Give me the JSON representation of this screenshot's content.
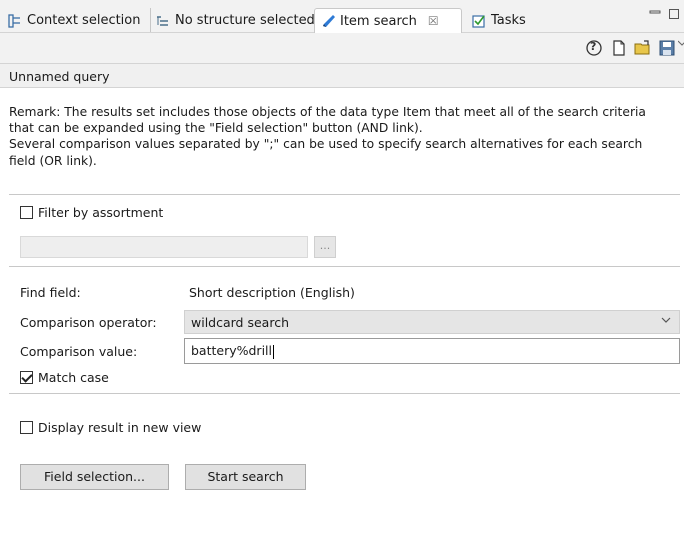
{
  "tabs": [
    {
      "label": "Context selection",
      "icon": "hierarchy-icon"
    },
    {
      "label": "No structure selected",
      "icon": "structure-icon"
    },
    {
      "label": "Item search",
      "icon": "pen-icon",
      "close": "☒",
      "active": true
    },
    {
      "label": "Tasks",
      "icon": "tasks-icon"
    }
  ],
  "toolbar": {
    "help": "?",
    "icons": [
      "help-icon",
      "new-document-icon",
      "open-folder-icon",
      "save-icon"
    ]
  },
  "query": {
    "title": "Unnamed query",
    "remark_lines": [
      "Remark: The results set includes those objects of the data type Item that meet all of the search criteria",
      "that can be expanded using the \"Field selection\" button (AND link).",
      "Several comparison values separated by \";\" can be used to specify search alternatives for each search",
      "field (OR link)."
    ],
    "filter_assortment": {
      "label": "Filter by assortment",
      "checked": false
    },
    "assortment_button": "...",
    "find_field": {
      "label": "Find field:",
      "value": "Short description (English)"
    },
    "comparison_operator": {
      "label": "Comparison operator:",
      "value": "wildcard search"
    },
    "comparison_value": {
      "label": "Comparison value:",
      "value": "battery%drill"
    },
    "match_case": {
      "label": "Match case",
      "checked": true
    },
    "display_new_view": {
      "label": "Display result in new view",
      "checked": false
    },
    "buttons": {
      "field_selection": "Field selection...",
      "start_search": "Start search"
    }
  }
}
